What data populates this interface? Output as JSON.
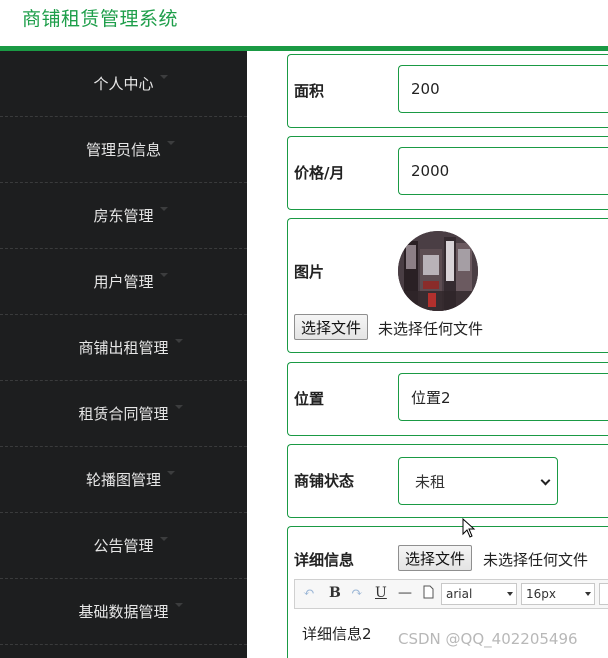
{
  "header": {
    "title": "商铺租赁管理系统"
  },
  "sidebar": {
    "items": [
      {
        "label": "个人中心"
      },
      {
        "label": "管理员信息"
      },
      {
        "label": "房东管理"
      },
      {
        "label": "用户管理"
      },
      {
        "label": "商铺出租管理"
      },
      {
        "label": "租赁合同管理"
      },
      {
        "label": "轮播图管理"
      },
      {
        "label": "公告管理"
      },
      {
        "label": "基础数据管理"
      }
    ]
  },
  "form": {
    "area": {
      "label": "面积",
      "value": "200"
    },
    "price": {
      "label": "价格/月",
      "value": "2000"
    },
    "image": {
      "label": "图片",
      "button": "选择文件",
      "status": "未选择任何文件"
    },
    "location": {
      "label": "位置",
      "value": "位置2"
    },
    "status": {
      "label": "商铺状态",
      "value": "未租"
    },
    "detail": {
      "label": "详细信息",
      "button": "选择文件",
      "status": "未选择任何文件",
      "font_family": "arial",
      "font_size": "16px",
      "content": "详细信息2"
    }
  },
  "watermark": "CSDN @QQ_402205496",
  "colors": {
    "accent": "#1a9a44",
    "sidebar_bg": "#1d1e1f",
    "title": "#1e9e4a"
  }
}
